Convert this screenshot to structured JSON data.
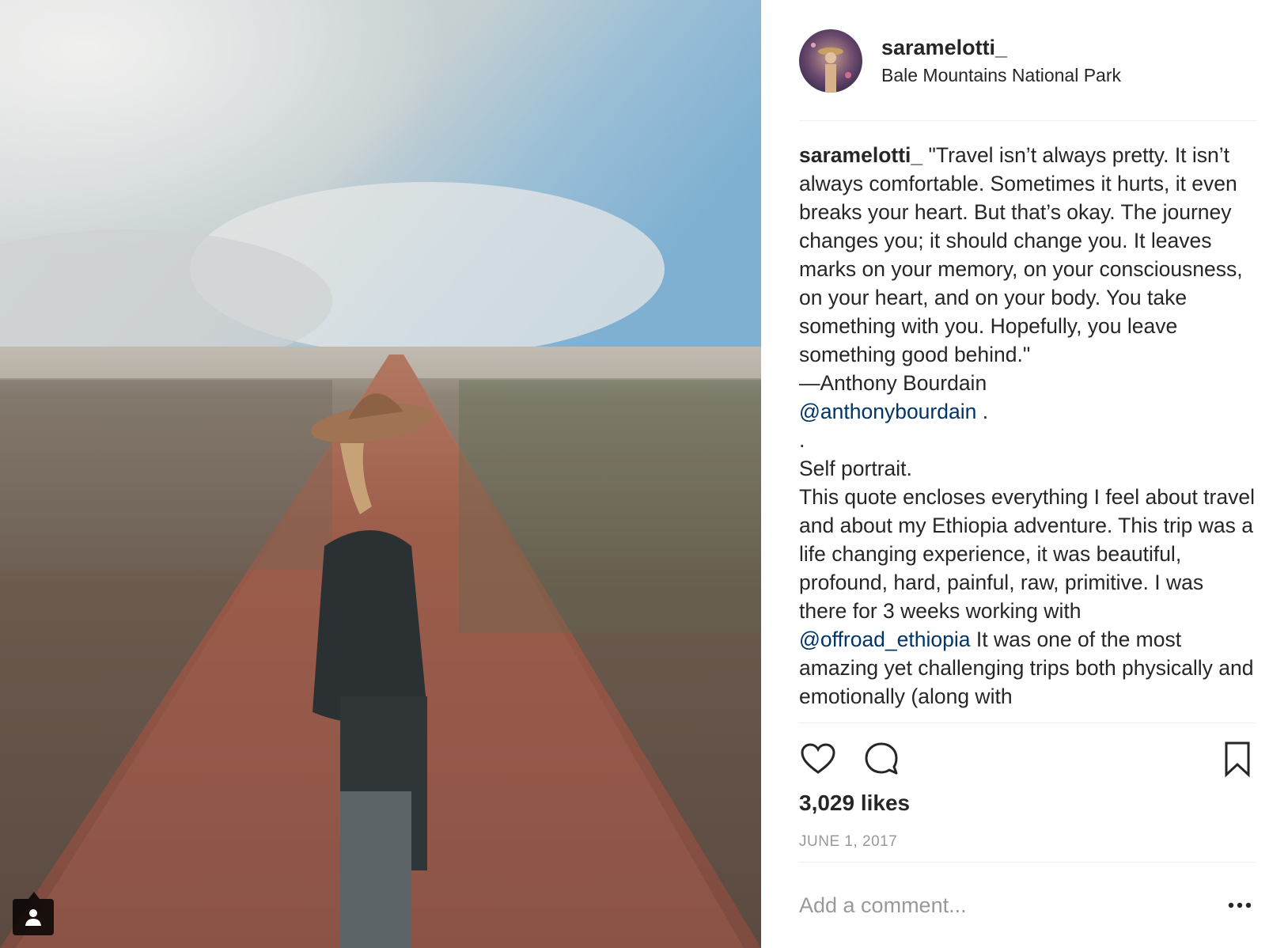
{
  "post": {
    "image_alt": "Self portrait on dirt road",
    "tag_icon": "user-tag-icon"
  },
  "header": {
    "username": "saramelotti_",
    "location": "Bale Mountains National Park"
  },
  "caption": {
    "username": "saramelotti_",
    "quote": "\"Travel isn’t always pretty. It isn’t always comfortable. Sometimes it hurts, it even breaks your heart. But that’s okay. The journey changes you; it should change you. It leaves marks on your memory, on your consciousness, on your heart, and on your body. You take something with you. Hopefully, you leave something good behind.\"",
    "author": "—Anthony Bourdain",
    "mention1": "@anthonybourdain",
    "mention1_suffix": " .",
    "dot": ".",
    "self_portrait": "Self portrait.",
    "body_before": "This quote encloses everything I feel about travel and about my Ethiopia adventure. This trip was a life changing experience, it was beautiful, profound, hard, painful, raw, primitive. I was there for 3 weeks working with ",
    "mention2": "@offroad_ethiopia",
    "body_after": " It was one of the most amazing yet challenging trips both physically and emotionally (along with"
  },
  "actions": {
    "like_icon": "heart-icon",
    "comment_icon": "comment-icon",
    "save_icon": "bookmark-icon"
  },
  "likes": "3,029 likes",
  "date": "JUNE 1, 2017",
  "comment": {
    "placeholder": "Add a comment...",
    "more_icon": "more-options-icon"
  },
  "colors": {
    "text": "#262626",
    "mention": "#003569",
    "muted": "#999999",
    "divider": "#efefef"
  }
}
